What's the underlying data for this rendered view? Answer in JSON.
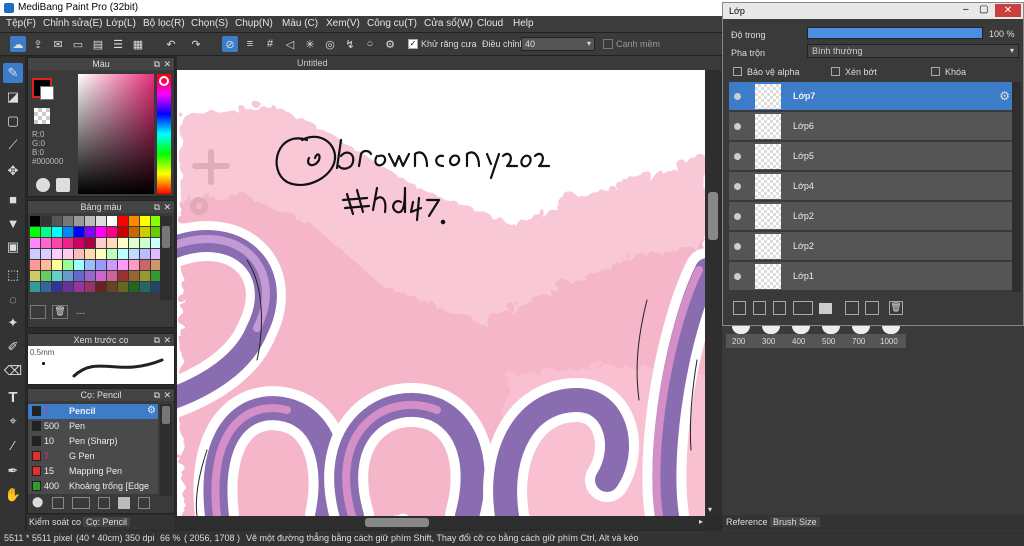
{
  "app": {
    "title": "MediBang Paint Pro (32bit)"
  },
  "menu": [
    "Tệp(F)",
    "Chỉnh sửa(E)",
    "Lớp(L)",
    "Bộ lọc(R)",
    "Chọn(S)",
    "Chụp(N)",
    "Màu (C)",
    "Xem(V)",
    "Công cụ(T)",
    "Cửa sổ(W)",
    "Cloud",
    "Help"
  ],
  "toolbar": {
    "antialias_label": "Khử răng cưa",
    "adjust_label": "Điều chỉnh",
    "adjust_value": "40",
    "margin_label": "Cạnh mềm"
  },
  "document": {
    "tab": "Untitled"
  },
  "color_panel": {
    "title": "Màu",
    "r": "R:0",
    "g": "G:0",
    "b": "B:0",
    "hex": "#000000"
  },
  "palette_panel": {
    "title": "Bảng màu",
    "footer": "---"
  },
  "preview_panel": {
    "title": "Xem trước cọ",
    "size": "0.5mm"
  },
  "brush_panel": {
    "title": "Cọ: Pencil",
    "items": [
      {
        "size": "7",
        "name": "Pencil",
        "color": "#222222"
      },
      {
        "size": "500",
        "name": "Pen",
        "color": "#222222"
      },
      {
        "size": "10",
        "name": "Pen (Sharp)",
        "color": "#222222"
      },
      {
        "size": "7",
        "name": "G Pen",
        "color": "#e03030"
      },
      {
        "size": "15",
        "name": "Mapping Pen",
        "color": "#e03030"
      },
      {
        "size": "400",
        "name": "Khoảng trống [Edge",
        "color": "#2aa02a"
      }
    ]
  },
  "left_bottom_tabs": [
    "Kiểm soát co",
    "Cọ: Pencil"
  ],
  "layer_panel": {
    "title": "Lớp",
    "opacity_label": "Độ trong",
    "opacity_value": "100 %",
    "opacity_fraction": 1.0,
    "blend_label": "Pha trộn",
    "blend_value": "Bình thường",
    "protect_alpha": "Bảo vệ alpha",
    "clip": "Xén bớt",
    "lock": "Khóa",
    "layers": [
      {
        "name": "Lớp7",
        "selected": true
      },
      {
        "name": "Lớp6",
        "selected": false
      },
      {
        "name": "Lớp5",
        "selected": false
      },
      {
        "name": "Lớp4",
        "selected": false
      },
      {
        "name": "Lớp2",
        "selected": false
      },
      {
        "name": "Lớp2",
        "selected": false
      },
      {
        "name": "Lớp1",
        "selected": false
      }
    ]
  },
  "brush_sizes": [
    "200",
    "300",
    "400",
    "500",
    "700",
    "1000"
  ],
  "right_tabs": [
    "Reference",
    "Brush Size"
  ],
  "status": {
    "dims": "5511 * 5511 pixel",
    "cm": "(40 * 40cm)",
    "dpi": "350 dpi",
    "zoom": "66 %",
    "coords": "( 2056, 1708 )",
    "hint": "Vẽ một đường thẳng bằng cách giữ phím Shift, Thay đổi cỡ cọ bằng cách giữ phím Ctrl, Alt và kéo"
  },
  "colors": {
    "accent": "#3d7cc9",
    "pink": "#f6bccd",
    "purple": "#8a6cb0"
  }
}
